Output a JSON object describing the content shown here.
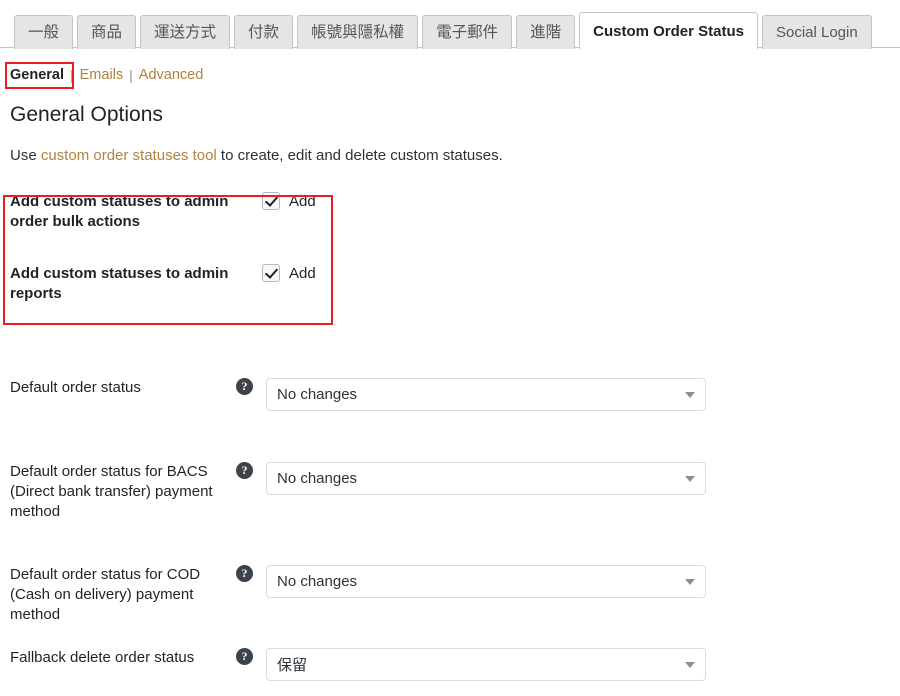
{
  "tabs": [
    {
      "label": "一般",
      "active": false,
      "cjk": true
    },
    {
      "label": "商品",
      "active": false,
      "cjk": true
    },
    {
      "label": "運送方式",
      "active": false,
      "cjk": true
    },
    {
      "label": "付款",
      "active": false,
      "cjk": true
    },
    {
      "label": "帳號與隱私權",
      "active": false,
      "cjk": true
    },
    {
      "label": "電子郵件",
      "active": false,
      "cjk": true
    },
    {
      "label": "進階",
      "active": false,
      "cjk": true
    },
    {
      "label": "Custom Order Status",
      "active": true,
      "cjk": false
    },
    {
      "label": "Social Login",
      "active": false,
      "cjk": false
    }
  ],
  "subnav": {
    "items": [
      {
        "label": "General",
        "current": true
      },
      {
        "label": "Emails",
        "current": false
      },
      {
        "label": "Advanced",
        "current": false
      }
    ],
    "separator": "|"
  },
  "heading": "General Options",
  "description": {
    "before": "Use ",
    "link": "custom order statuses tool",
    "after": " to create, edit and delete custom statuses."
  },
  "checkbox_rows": [
    {
      "label": "Add custom statuses to admin order bulk actions",
      "checkbox_label": "Add",
      "checked": true
    },
    {
      "label": "Add custom statuses to admin reports",
      "checkbox_label": "Add",
      "checked": true
    }
  ],
  "select_rows": [
    {
      "label": "Default order status",
      "help": "?",
      "value": "No changes"
    },
    {
      "label": "Default order status for BACS (Direct bank transfer) payment method",
      "help": "?",
      "value": "No changes"
    },
    {
      "label": "Default order status for COD (Cash on delivery) payment method",
      "help": "?",
      "value": "No changes"
    },
    {
      "label": "Fallback delete order status",
      "help": "?",
      "value": "保留"
    }
  ],
  "annotations": {
    "color": "#ed1c24",
    "general_link_highlight": true,
    "checkbox_group_highlight": true
  },
  "colors": {
    "link": "#b4823c",
    "active_tab_bg": "#ffffff",
    "tab_bg": "#e5e5e5",
    "annotation_red": "#ed1c24"
  }
}
